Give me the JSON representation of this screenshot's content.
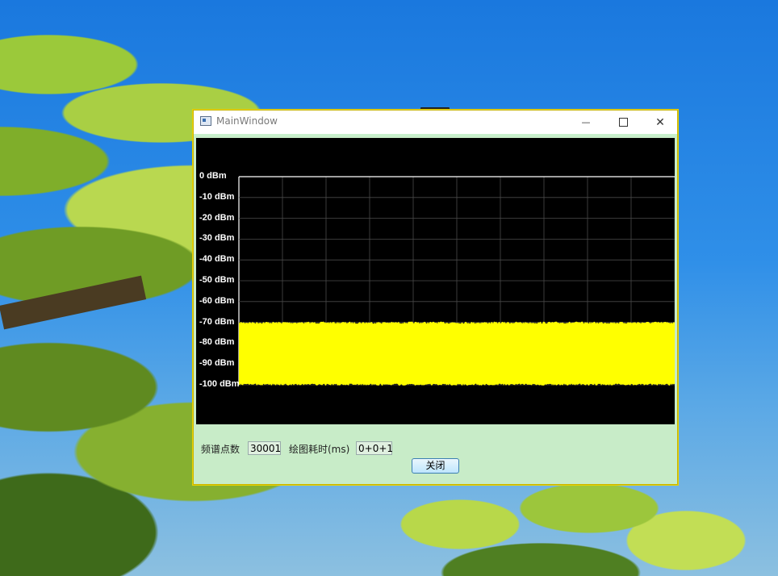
{
  "window": {
    "title": "MainWindow",
    "minimize_glyph": "—",
    "close_glyph": "✕"
  },
  "spectrum": {
    "y_labels": [
      "0 dBm",
      "-10 dBm",
      "-20 dBm",
      "-30 dBm",
      "-40 dBm",
      "-50 dBm",
      "-60 dBm",
      "-70 dBm",
      "-80 dBm",
      "-90 dBm",
      "-100 dBm"
    ],
    "colors": {
      "background": "#000000",
      "grid": "#4a4a4a",
      "trace": "#ffff00",
      "axis": "#ffffff"
    }
  },
  "chart_data": {
    "type": "area",
    "y_labels": [
      "0 dBm",
      "-10 dBm",
      "-20 dBm",
      "-30 dBm",
      "-40 dBm",
      "-50 dBm",
      "-60 dBm",
      "-70 dBm",
      "-80 dBm",
      "-90 dBm",
      "-100 dBm"
    ],
    "ylim": [
      -100,
      0
    ],
    "x_divisions": 10,
    "grid": true,
    "series": [
      {
        "upper_envelope_dbm": -70,
        "lower_envelope_dbm": -100,
        "points": 30001
      }
    ]
  },
  "controls": {
    "points_label": "频谱点数",
    "points_value": "30001",
    "time_label": "绘图耗时(ms)",
    "time_value": "0+0+1",
    "close_button": "关闭"
  }
}
